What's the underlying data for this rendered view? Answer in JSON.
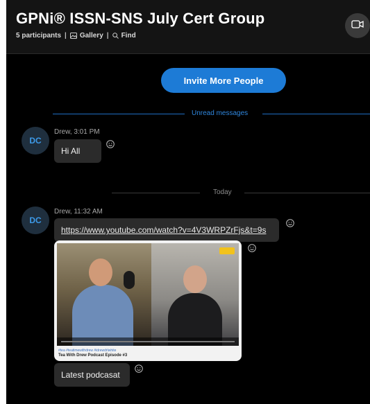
{
  "header": {
    "title": "GPNi® ISSN-SNS July Cert Group",
    "participants": "5 participants",
    "gallery": "Gallery",
    "find": "Find",
    "separator": "|",
    "video_icon": "video-camera-icon"
  },
  "invite": {
    "label": "Invite More People"
  },
  "unread_separator": "Unread messages",
  "today_separator": "Today",
  "messages": [
    {
      "avatar": "DC",
      "meta": "Drew, 3:01 PM",
      "text": "Hi All"
    },
    {
      "avatar": "DC",
      "meta": "Drew, 11:32 AM",
      "link": "https://www.youtube.com/watch?v=4V3WRPZrFjs&t=9s",
      "preview": {
        "tags": "#tea #teatimewithdrew #idrewdrlwhite",
        "title": "Tea With Drew Podcast Episode #3"
      },
      "text": "Latest podcasat"
    }
  ],
  "colors": {
    "accent": "#1d7bd6",
    "bubble": "#2b2b2b",
    "avatar_text": "#3d9ae8"
  }
}
